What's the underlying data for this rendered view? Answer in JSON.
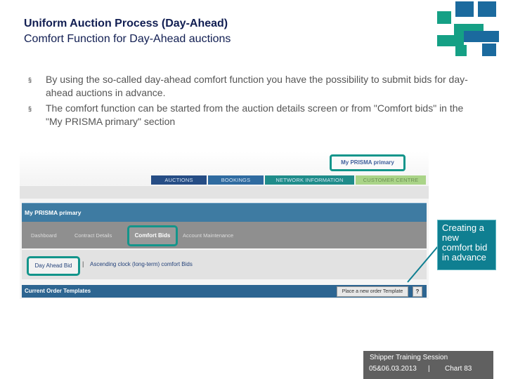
{
  "slide": {
    "title": "Uniform Auction Process (Day-Ahead)",
    "subtitle": "Comfort Function for Day-Ahead auctions",
    "bullets": [
      "By using the so-called day-ahead comfort function you have the possibility to submit bids for day-ahead auctions in advance.",
      "The comfort function can be started from the auction details screen or from \"Comfort bids\" in the \"My PRISMA primary\" section"
    ],
    "bullet_mark": "§"
  },
  "screenshot": {
    "myprisma_link": "My PRISMA primary",
    "nav_tabs": [
      "AUCTIONS",
      "BOOKINGS",
      "NETWORK INFORMATION",
      "CUSTOMER CENTRE"
    ],
    "panel_title": "My PRISMA primary",
    "subnav": [
      "Dashboard",
      "Contract Details",
      "Comfort Bids",
      "Account Maintenance"
    ],
    "day_ahead_bid": "Day Ahead Bid",
    "separator": "|",
    "ascending_clock": "Ascending clock (long-term) comfort Bids",
    "templates_title": "Current Order Templates",
    "place_template": "Place a new order Template",
    "help": "?"
  },
  "callout": {
    "text": "Creating a new comfort bid in advance"
  },
  "footer": {
    "session": "Shipper Training Session",
    "date": "05&06.03.2013",
    "separator": "|",
    "chart": "Chart 83"
  },
  "colors": {
    "title": "#111e52",
    "accent_teal": "#13958b",
    "callout_bg": "#0f7f91",
    "footer_bg": "#606060",
    "logo_green": "#15a085",
    "logo_blue": "#1b6a9e"
  }
}
